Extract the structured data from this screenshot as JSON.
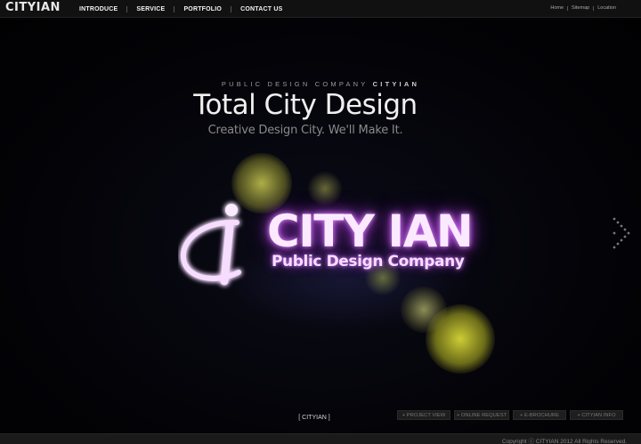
{
  "header": {
    "brand": "CITYIAN",
    "nav": [
      {
        "label": "INTRODUCE"
      },
      {
        "label": "SERVICE"
      },
      {
        "label": "PORTFOLIO"
      },
      {
        "label": "CONTACT US"
      }
    ],
    "utility": [
      {
        "label": "Home"
      },
      {
        "label": "Sitemap"
      },
      {
        "label": "Location"
      }
    ]
  },
  "hero": {
    "kicker_prefix": "PUBLIC DESIGN COMPANY",
    "kicker_brand": "CITYIAN",
    "title": "Total City Design",
    "tagline": "Creative Design City. We'll Make It.",
    "logo_word": "CITY IAN",
    "logo_sub": "Public Design Company",
    "caption": "[ CITYIAN ]"
  },
  "quick_links": [
    {
      "label": "+ PROJECT VIEW"
    },
    {
      "label": "+ ONLINE REQUEST"
    },
    {
      "label": "+ E-BROCHURE"
    },
    {
      "label": "+ CITYIAN INFO"
    }
  ],
  "footer": {
    "copyright": "Copyright ⓒ CITYIAN 2012 All Rights Reserved."
  },
  "icons": {
    "next": "chevron-right-icon",
    "logo": "cityian-logo-mark-icon"
  },
  "colors": {
    "background": "#020205",
    "logo_glow": "#b24be0",
    "bokeh": "#e6e65a",
    "nav_bar": "#111111"
  }
}
